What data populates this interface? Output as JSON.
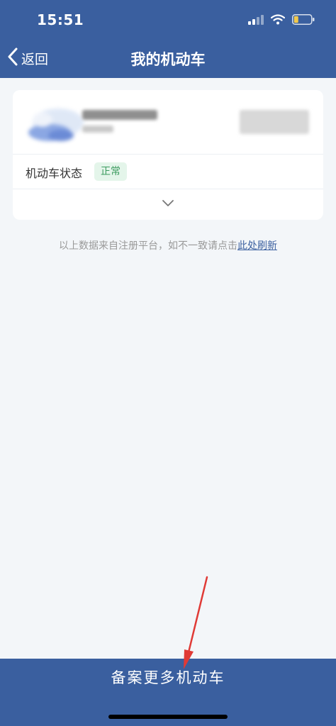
{
  "status_bar": {
    "time": "15:51",
    "icons": [
      "cellular-signal-icon",
      "wifi-icon",
      "battery-icon"
    ]
  },
  "nav": {
    "back_icon": "chevron-left-icon",
    "back_label": "返回",
    "title": "我的机动车"
  },
  "vehicle_card": {
    "status_label": "机动车状态",
    "status_value": "正常",
    "expand_icon": "chevron-down-icon"
  },
  "note": {
    "text": "以上数据来自注册平台，如不一致请点击",
    "link": "此处刷新"
  },
  "bottom_button": {
    "label": "备案更多机动车"
  },
  "colors": {
    "brand": "#3a5f9f",
    "background": "#f3f6f9",
    "status_ok_text": "#3c9b5f",
    "status_ok_bg": "#e4f5ea",
    "annotation_arrow": "#e03a36"
  }
}
